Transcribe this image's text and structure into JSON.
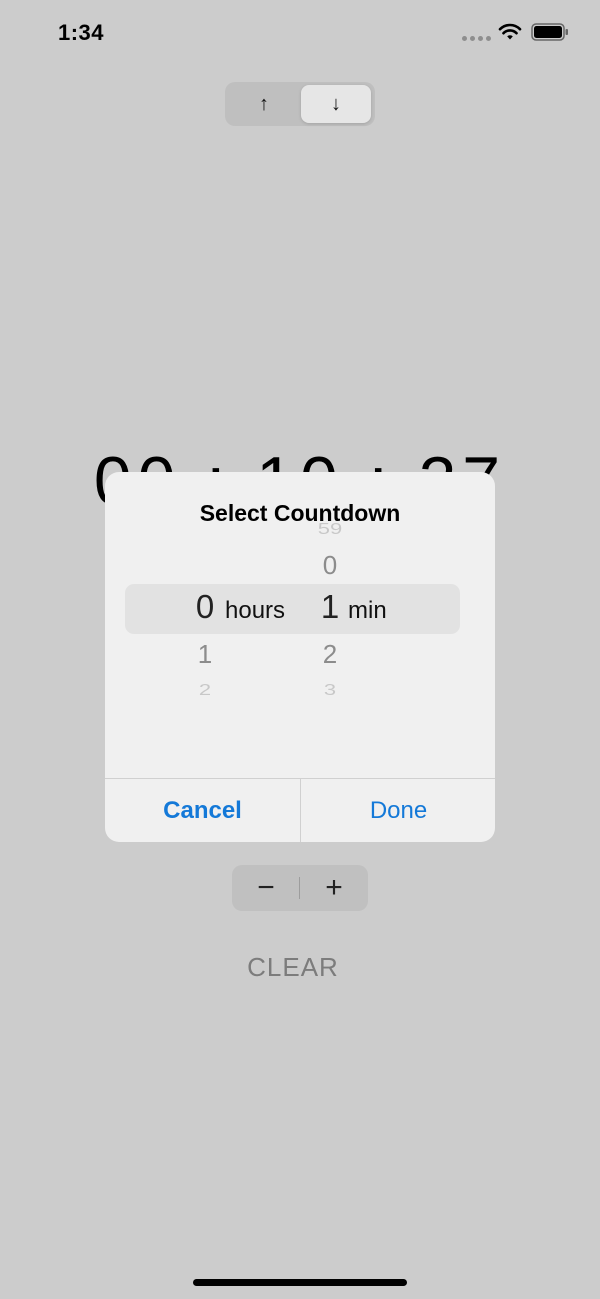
{
  "status_bar": {
    "time": "1:34",
    "icons": [
      "signal-dots-icon",
      "wifi-icon",
      "battery-icon"
    ]
  },
  "direction_toggle": {
    "up_label": "↑",
    "down_label": "↓",
    "selected": "down"
  },
  "timer_display": {
    "value": "00 : 10 : 27"
  },
  "stepper": {
    "minus_label": "−",
    "plus_label": "+"
  },
  "clear_button": {
    "label": "CLEAR"
  },
  "dialog": {
    "title": "Select Countdown",
    "hours_wheel": {
      "above": "",
      "selected": "0",
      "below": [
        "1",
        "2"
      ],
      "unit": "hours"
    },
    "minutes_wheel": {
      "above": [
        "59",
        "0"
      ],
      "selected": "1",
      "below": [
        "2",
        "3"
      ],
      "unit": "min"
    },
    "cancel_label": "Cancel",
    "done_label": "Done"
  },
  "colors": {
    "background": "#cccccc",
    "dialog_background": "#f0f0f0",
    "accent": "#1479d8"
  }
}
